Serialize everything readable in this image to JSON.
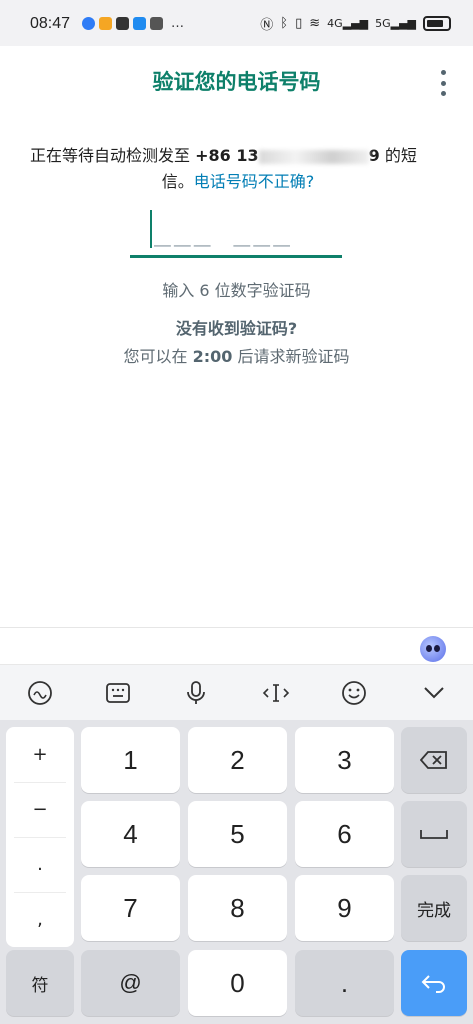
{
  "status_bar": {
    "time": "08:47",
    "more": "…",
    "signal_labels": [
      "4G",
      "5G"
    ],
    "app_icon_colors": [
      "#2f7cf6",
      "#f5a623",
      "#333333",
      "#1f8bf0",
      "#555555"
    ]
  },
  "header": {
    "title": "验证您的电话号码"
  },
  "info": {
    "prefix": "正在等待自动检测发至 ",
    "phone_visible_start": "+86 13",
    "phone_visible_end": "9",
    "suffix": " 的短",
    "line2_prefix": "信。",
    "wrong_number_link": "电话号码不正确?"
  },
  "code_input": {
    "dashes": "___ ___"
  },
  "hint": "输入 6 位数字验证码",
  "no_code": "没有收到验证码?",
  "resend": {
    "prefix": "您可以在 ",
    "time": "2:00",
    "suffix": " 后请求新验证码"
  },
  "keyboard": {
    "symbols": [
      "+",
      "−",
      ".",
      ","
    ],
    "digits": [
      "1",
      "2",
      "3",
      "4",
      "5",
      "6",
      "7",
      "8",
      "9",
      "0"
    ],
    "symbol_key": "符",
    "at_key": "@",
    "dot_key": ".",
    "done_key": "完成",
    "accent_color": "#4a9df8"
  },
  "colors": {
    "brand": "#0e806a",
    "link": "#027eb5"
  }
}
